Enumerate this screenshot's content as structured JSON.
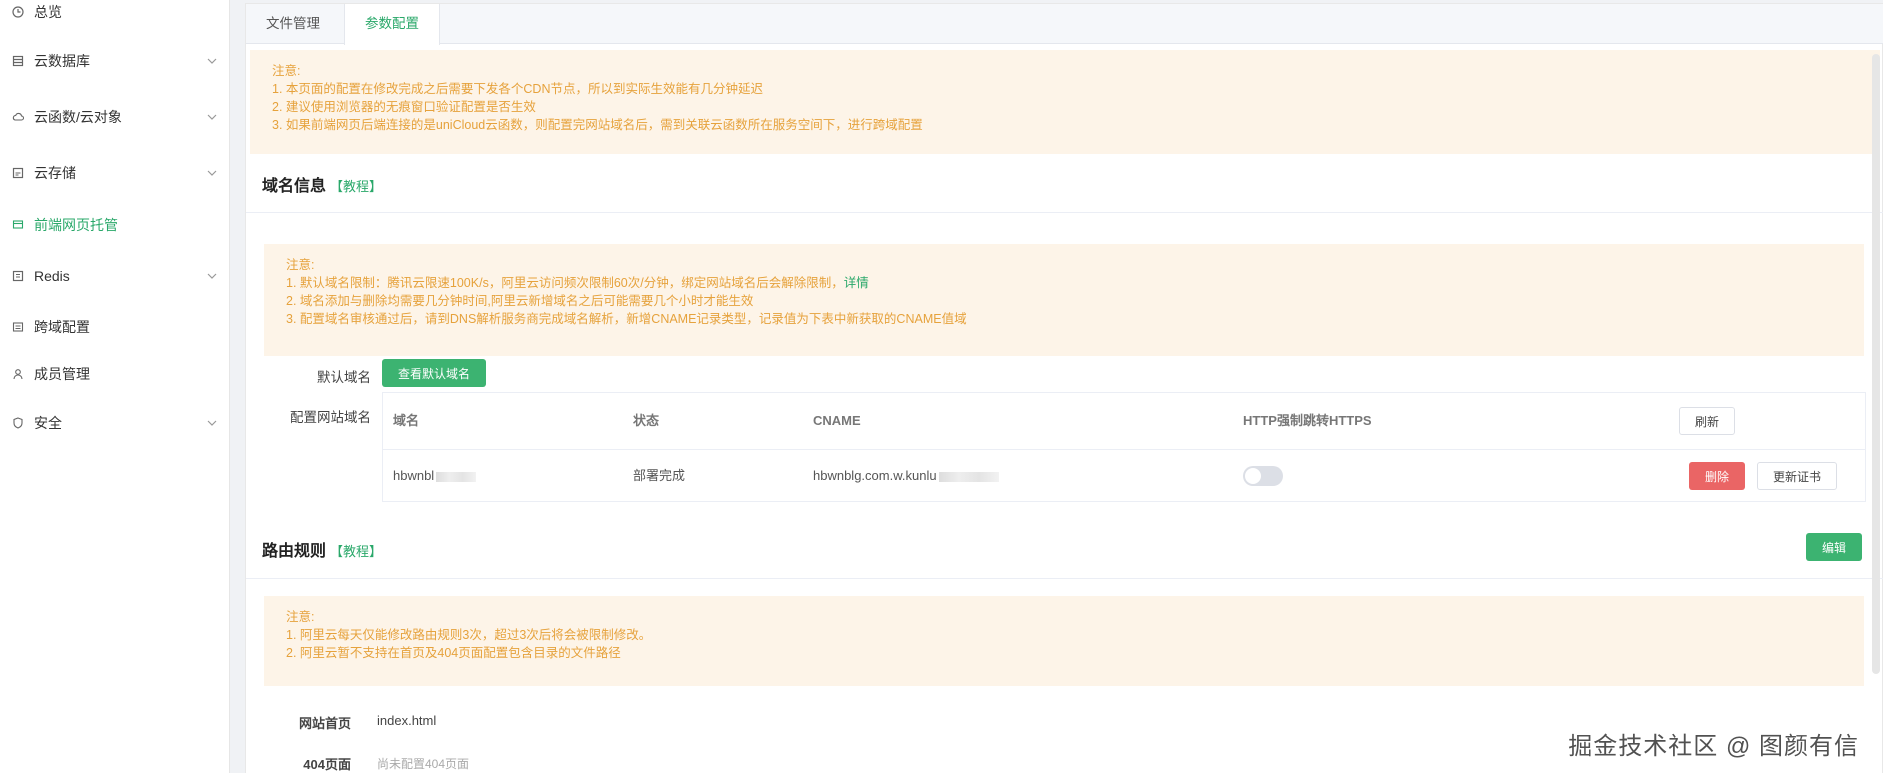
{
  "sidebar": {
    "items": [
      {
        "label": "总览",
        "icon": "clock-icon",
        "has_chevron": false
      },
      {
        "label": "云数据库",
        "icon": "database-icon",
        "has_chevron": true
      },
      {
        "label": "云函数/云对象",
        "icon": "cloud-icon",
        "has_chevron": true
      },
      {
        "label": "云存储",
        "icon": "storage-icon",
        "has_chevron": true
      },
      {
        "label": "前端网页托管",
        "icon": "web-hosting-icon",
        "has_chevron": false,
        "active": true
      },
      {
        "label": "Redis",
        "icon": "redis-icon",
        "has_chevron": true
      },
      {
        "label": "跨域配置",
        "icon": "cross-domain-icon",
        "has_chevron": false
      },
      {
        "label": "成员管理",
        "icon": "user-icon",
        "has_chevron": false
      },
      {
        "label": "安全",
        "icon": "shield-icon",
        "has_chevron": true
      }
    ]
  },
  "tabs": [
    {
      "label": "文件管理",
      "active": false
    },
    {
      "label": "参数配置",
      "active": true
    }
  ],
  "top_notice": {
    "title": "注意:",
    "lines": [
      "1. 本页面的配置在修改完成之后需要下发各个CDN节点，所以到实际生效能有几分钟延迟",
      "2. 建议使用浏览器的无痕窗口验证配置是否生效",
      "3. 如果前端网页后端连接的是uniCloud云函数，则配置完网站域名后，需到关联云函数所在服务空间下，进行跨域配置"
    ]
  },
  "domain_section": {
    "title": "域名信息",
    "tutorial": "【教程】",
    "notice": {
      "title": "注意:",
      "line1": "1. 默认域名限制：腾讯云限速100K/s，阿里云访问频次限制60次/分钟，绑定网站域名后会解除限制，",
      "line1_link": "详情",
      "line2": "2. 域名添加与删除均需要几分钟时间,阿里云新增域名之后可能需要几个小时才能生效",
      "line3": "3. 配置域名审核通过后，请到DNS解析服务商完成域名解析，新增CNAME记录类型，记录值为下表中新获取的CNAME值域"
    },
    "default_domain_label": "默认域名",
    "view_default_button": "查看默认域名",
    "config_domain_label": "配置网站域名",
    "table": {
      "headers": [
        "域名",
        "状态",
        "CNAME",
        "HTTP强制跳转HTTPS"
      ],
      "refresh_button": "刷新",
      "row": {
        "domain": "hbwnbl",
        "status": "部署完成",
        "cname": "hbwnblg.com.w.kunlu",
        "https_redirect": false,
        "delete_button": "删除",
        "update_cert_button": "更新证书"
      }
    }
  },
  "route_section": {
    "title": "路由规则",
    "tutorial": "【教程】",
    "edit_button": "编辑",
    "notice": {
      "title": "注意:",
      "lines": [
        "1. 阿里云每天仅能修改路由规则3次，超过3次后将会被限制修改。",
        "2. 阿里云暂不支持在首页及404页面配置包含目录的文件路径"
      ]
    },
    "homepage_label": "网站首页",
    "homepage_value": "index.html",
    "page404_label": "404页面",
    "page404_value": "尚未配置404页面"
  },
  "watermark": "掘金技术社区 @ 图颜有信",
  "colors": {
    "accent": "#2aa86a",
    "warning_bg": "#fdf4e8",
    "warning_text": "#e6a23c",
    "danger": "#ea6565"
  }
}
